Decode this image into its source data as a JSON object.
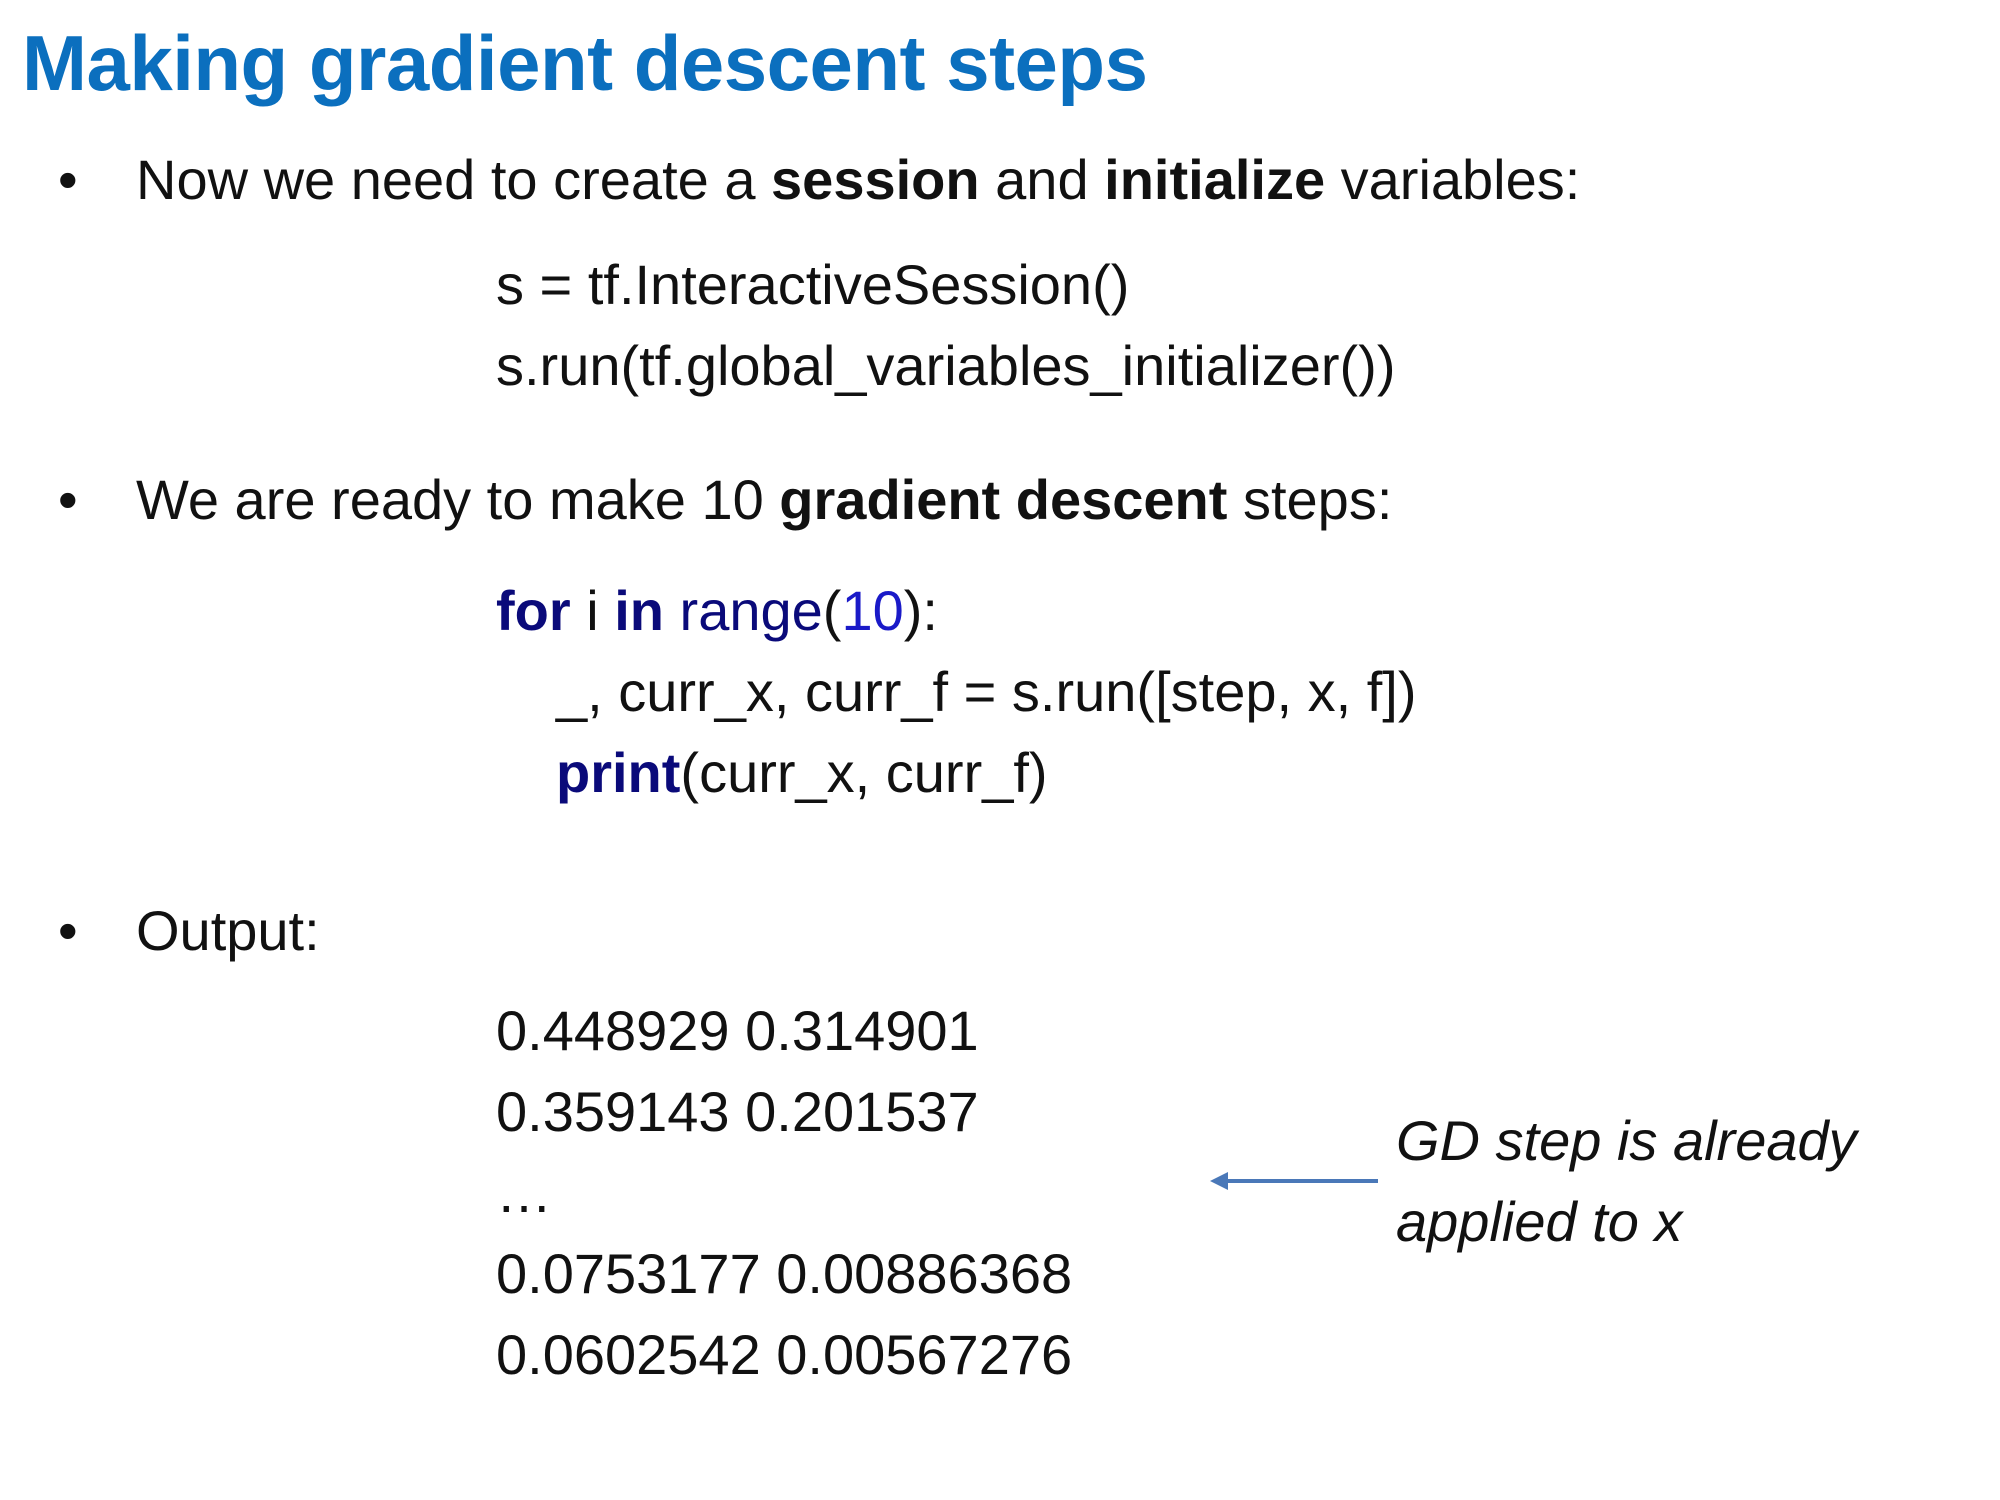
{
  "slide": {
    "title": "Making gradient descent steps"
  },
  "bullets": [
    {
      "marker": "•",
      "pre": "Now we need to create a ",
      "bold1": "session",
      "mid": " and ",
      "bold2": "initialize",
      "post": " variables:"
    },
    {
      "marker": "•",
      "pre": "We are ready to make 10 ",
      "bold": "gradient descent",
      "post": " steps:"
    },
    {
      "marker": "•",
      "text": "Output:"
    }
  ],
  "code_session": {
    "line1": "s = tf.InteractiveSession()",
    "line2": "s.run(tf.global_variables_initializer())"
  },
  "code_loop": {
    "kw_for": "for",
    "var_i": " i ",
    "kw_in": "in",
    "sp": " ",
    "fn_range": "range",
    "paren_open": "(",
    "num_10": "10",
    "paren_close": "):",
    "line2": "_, curr_x, curr_f = s.run([step, x, f])",
    "fn_print": "print",
    "print_args": "(curr_x, curr_f)"
  },
  "output_lines": [
    "0.448929 0.314901",
    "0.359143 0.201537",
    "…",
    "0.0753177 0.00886368",
    "0.0602542 0.00567276"
  ],
  "annotation": {
    "line1": "GD step is already",
    "line2": "applied to x",
    "arrow_color": "#4a78b8"
  }
}
